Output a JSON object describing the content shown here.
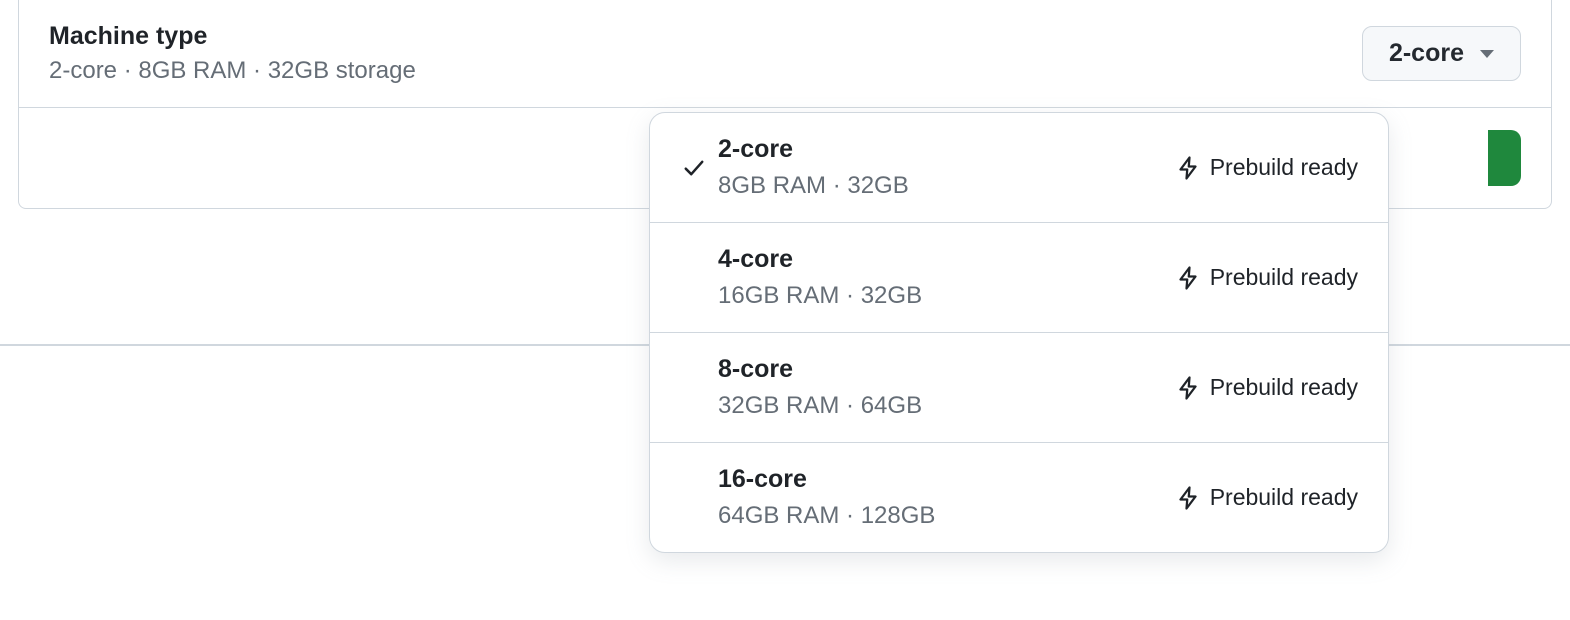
{
  "section": {
    "title": "Machine type",
    "subtitle": "2-core · 8GB RAM · 32GB storage",
    "selected": "2-core"
  },
  "dropdown": {
    "prebuild_label": "Prebuild ready",
    "options": [
      {
        "name": "2-core",
        "spec": "8GB RAM · 32GB",
        "selected": true
      },
      {
        "name": "4-core",
        "spec": "16GB RAM · 32GB",
        "selected": false
      },
      {
        "name": "8-core",
        "spec": "32GB RAM · 64GB",
        "selected": false
      },
      {
        "name": "16-core",
        "spec": "64GB RAM · 128GB",
        "selected": false
      }
    ]
  }
}
